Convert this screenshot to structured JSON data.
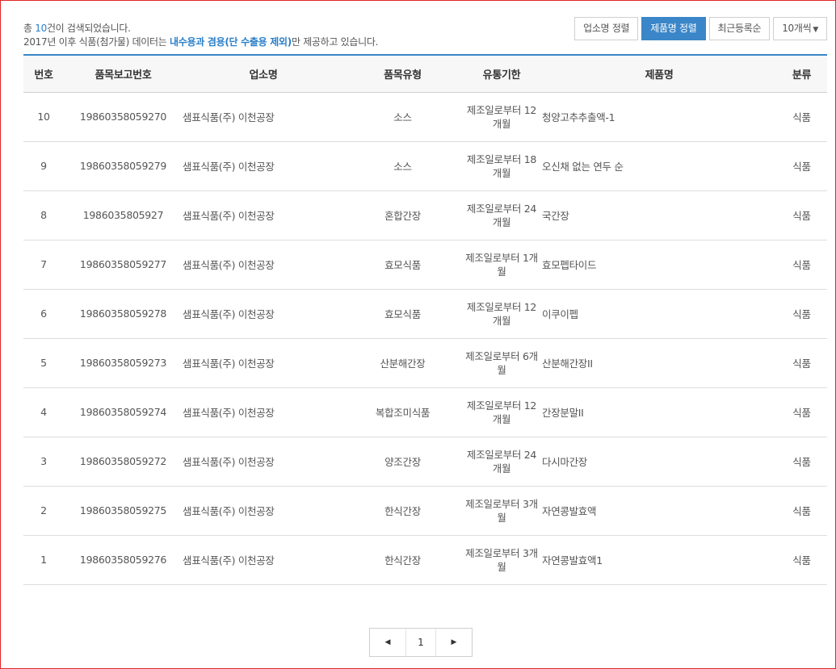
{
  "summary": {
    "prefix": "총 ",
    "count": "10",
    "suffix": "건이 검색되었습니다.",
    "notice_prefix": "2017년 이후 식품(첨가물) 데이터는 ",
    "notice_highlight": "내수용과 겸용(단 수출용 제외)",
    "notice_suffix": "만 제공하고 있습니다."
  },
  "sort_buttons": [
    {
      "label": "업소명 정렬",
      "active": false
    },
    {
      "label": "제품명 정렬",
      "active": true
    },
    {
      "label": "최근등록순",
      "active": false
    }
  ],
  "page_size": {
    "label": "10개씩",
    "caret": "▼"
  },
  "table": {
    "headers": [
      "번호",
      "품목보고번호",
      "업소명",
      "품목유형",
      "유통기한",
      "제품명",
      "분류"
    ],
    "rows": [
      {
        "no": "10",
        "report_no": "19860358059270",
        "company": "샘표식품(주) 이천공장",
        "type": "소스",
        "expiry": "제조일로부터 12개월",
        "product": "청양고추추출액-1",
        "category": "식품"
      },
      {
        "no": "9",
        "report_no": "19860358059279",
        "company": "샘표식품(주) 이천공장",
        "type": "소스",
        "expiry": "제조일로부터 18개월",
        "product": "오신채 없는 연두 순",
        "category": "식품"
      },
      {
        "no": "8",
        "report_no": "1986035805927",
        "company": "샘표식품(주) 이천공장",
        "type": "혼합간장",
        "expiry": "제조일로부터 24개월",
        "product": "국간장",
        "category": "식품"
      },
      {
        "no": "7",
        "report_no": "19860358059277",
        "company": "샘표식품(주) 이천공장",
        "type": "효모식품",
        "expiry": "제조일로부터 1개월",
        "product": "효모펩타이드",
        "category": "식품"
      },
      {
        "no": "6",
        "report_no": "19860358059278",
        "company": "샘표식품(주) 이천공장",
        "type": "효모식품",
        "expiry": "제조일로부터 12 개월",
        "product": "이쿠이펩",
        "category": "식품"
      },
      {
        "no": "5",
        "report_no": "19860358059273",
        "company": "샘표식품(주) 이천공장",
        "type": "산분해간장",
        "expiry": "제조일로부터 6개월",
        "product": "산분해간장II",
        "category": "식품"
      },
      {
        "no": "4",
        "report_no": "19860358059274",
        "company": "샘표식품(주) 이천공장",
        "type": "복합조미식품",
        "expiry": "제조일로부터 12개월",
        "product": "간장분말II",
        "category": "식품"
      },
      {
        "no": "3",
        "report_no": "19860358059272",
        "company": "샘표식품(주) 이천공장",
        "type": "양조간장",
        "expiry": "제조일로부터 24 개월",
        "product": "다시마간장",
        "category": "식품"
      },
      {
        "no": "2",
        "report_no": "19860358059275",
        "company": "샘표식품(주) 이천공장",
        "type": "한식간장",
        "expiry": "제조일로부터 3개월",
        "product": "자연콩발효액",
        "category": "식품"
      },
      {
        "no": "1",
        "report_no": "19860358059276",
        "company": "샘표식품(주) 이천공장",
        "type": "한식간장",
        "expiry": "제조일로부터 3개월",
        "product": "자연콩발효액1",
        "category": "식품"
      }
    ]
  },
  "pagination": {
    "prev": "◀",
    "current": "1",
    "next": "▶"
  },
  "colors": {
    "accent": "#3a86c8",
    "highlight_text": "#2a7fc9",
    "frame": "#e0262b"
  }
}
